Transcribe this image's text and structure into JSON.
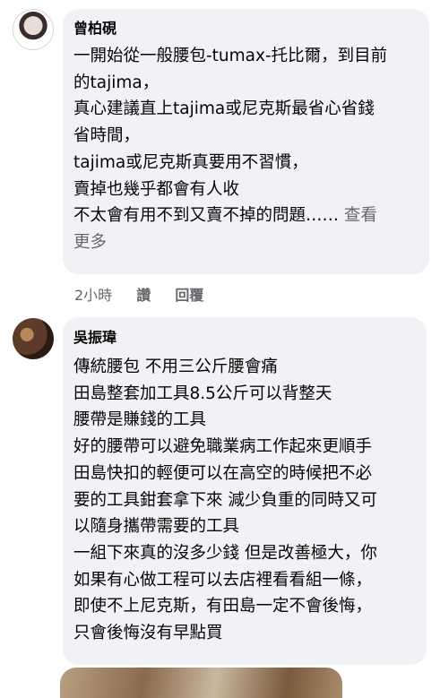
{
  "comments": [
    {
      "author": "曾柏硯",
      "lines": [
        "一開始從一般腰包-tumax-托比爾，到目前",
        "的tajima，",
        "真心建議直上tajima或尼克斯最省心省錢",
        "省時間，",
        "tajima或尼克斯真要用不習慣，",
        "賣掉也幾乎都會有人收",
        "不太會有用不到又賣不掉的問題……"
      ],
      "see_more_1": "查看",
      "see_more_2": "更多",
      "time": "2小時",
      "like": "讚",
      "reply": "回覆"
    },
    {
      "author": "吳振瑋",
      "lines": [
        "傳統腰包 不用三公斤腰會痛",
        "田島整套加工具8.5公斤可以背整天",
        "腰帶是賺錢的工具",
        "好的腰帶可以避免職業病工作起來更順手",
        "田島快扣的輕便可以在高空的時候把不必",
        "要的工具鉗套拿下來 減少負重的同時又可",
        "以隨身攜帶需要的工具",
        "一組下來真的沒多少錢 但是改善極大，你",
        "如果有心做工程可以去店裡看看組一條，",
        "即使不上尼克斯，有田島一定不會後悔，",
        "只會後悔沒有早點買"
      ]
    }
  ]
}
